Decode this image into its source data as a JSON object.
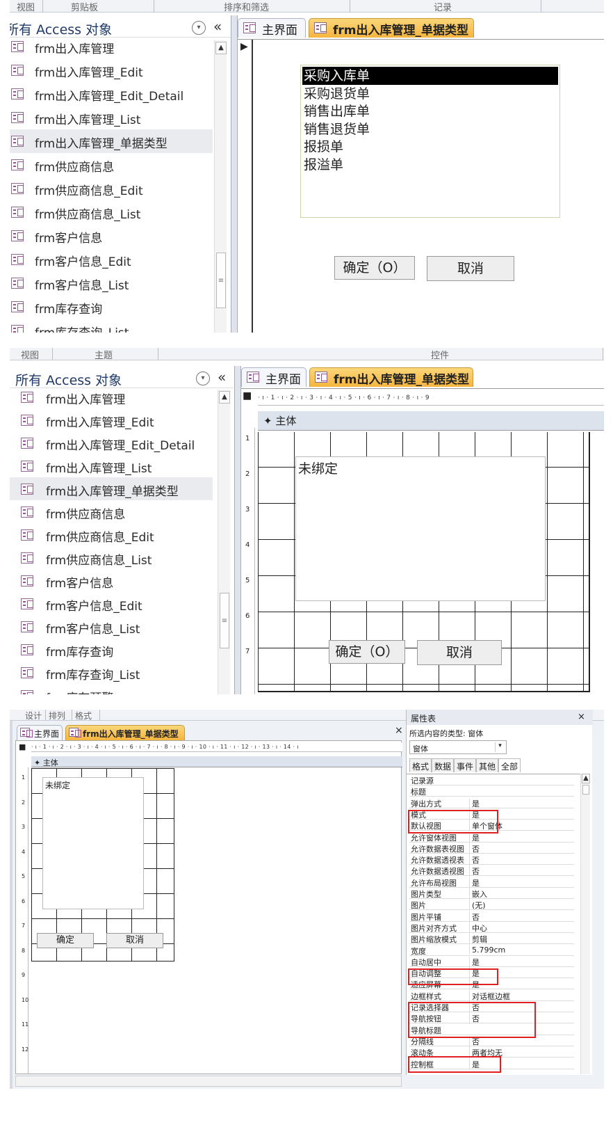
{
  "nav": {
    "title": "所有 Access 对象",
    "dropdown_glyph": "▾",
    "collapse_glyph": "«",
    "scroll_up": "▲",
    "thumb_grip": "≡",
    "items": [
      "frm出入库管理",
      "frm出入库管理_Edit",
      "frm出入库管理_Edit_Detail",
      "frm出入库管理_List",
      "frm出入库管理_单据类型",
      "frm供应商信息",
      "frm供应商信息_Edit",
      "frm供应商信息_List",
      "frm客户信息",
      "frm客户信息_Edit",
      "frm客户信息_List",
      "frm库存查询",
      "frm库存查询_List",
      "frm库存预警"
    ]
  },
  "panel1": {
    "top_segments": [
      "视图",
      "剪贴板",
      "排序和筛选",
      "记录"
    ],
    "record_marker": "▶",
    "listbox_items": [
      "采购入库单",
      "采购退货单",
      "销售出库单",
      "销售退货单",
      "报损单",
      "报溢单"
    ],
    "ok_button": "确定（O）",
    "cancel_button": "取消"
  },
  "tabs": {
    "home": "主界面",
    "form": "frm出入库管理_单据类型"
  },
  "panel2": {
    "top_segments": [
      "视图",
      "主题",
      "控件"
    ],
    "ruler_corner": "■",
    "ruler_text": "· ı · 1 · ı · 2 · ı · 3 · ı · 4 · ı · 5 · ı · 6 · ı · 7 · ı · 8 · ı · 9",
    "vruler_numbers": [
      "1",
      "2",
      "3",
      "4",
      "5",
      "6",
      "7"
    ],
    "section_glyph": "✦",
    "section_label": "主体",
    "unbound_label": "未绑定",
    "ok_button": "确定（O）",
    "cancel_button": "取消"
  },
  "panel3": {
    "top_segments": [
      "设计",
      "排列",
      "格式"
    ],
    "close_glyph": "×",
    "ruler_text": "· ı · 1 · ı · 2 · ı · 3 · ı · 4 · ı · 5 · ı · 6 · ı · 7 · ı · 8 · ı · 9 · ı · 10 · ı · 11 · ı · 12 · ı · 13 · ı · 14 · ı",
    "vruler_numbers": [
      "1",
      "2",
      "3",
      "4",
      "5",
      "6",
      "7",
      "8",
      "9",
      "10",
      "11",
      "12"
    ],
    "unbound_label": "未绑定",
    "ok_button": "确定",
    "cancel_button": "取消",
    "property_sheet": {
      "title": "属性表",
      "selection_type": "所选内容的类型: 窗体",
      "object_combo": "窗体",
      "tabs": [
        "格式",
        "数据",
        "事件",
        "其他",
        "全部"
      ],
      "rows": [
        {
          "name": "记录源",
          "value": ""
        },
        {
          "name": "标题",
          "value": ""
        },
        {
          "name": "弹出方式",
          "value": "是"
        },
        {
          "name": "模式",
          "value": "是"
        },
        {
          "name": "默认视图",
          "value": "单个窗体"
        },
        {
          "name": "允许窗体视图",
          "value": "是"
        },
        {
          "name": "允许数据表视图",
          "value": "否"
        },
        {
          "name": "允许数据透视表",
          "value": "否"
        },
        {
          "name": "允许数据透视图",
          "value": "否"
        },
        {
          "name": "允许布局视图",
          "value": "是"
        },
        {
          "name": "图片类型",
          "value": "嵌入"
        },
        {
          "name": "图片",
          "value": "(无)"
        },
        {
          "name": "图片平铺",
          "value": "否"
        },
        {
          "name": "图片对齐方式",
          "value": "中心"
        },
        {
          "name": "图片缩放模式",
          "value": "剪辑"
        },
        {
          "name": "宽度",
          "value": "5.799cm"
        },
        {
          "name": "自动居中",
          "value": "是"
        },
        {
          "name": "自动调整",
          "value": "是"
        },
        {
          "name": "适应屏幕",
          "value": "是"
        },
        {
          "name": "边框样式",
          "value": "对话框边框"
        },
        {
          "name": "记录选择器",
          "value": "否"
        },
        {
          "name": "导航按钮",
          "value": "否"
        },
        {
          "name": "导航标题",
          "value": ""
        },
        {
          "name": "分隔线",
          "value": "否"
        },
        {
          "name": "滚动条",
          "value": "两者均无"
        },
        {
          "name": "控制框",
          "value": "是"
        }
      ]
    }
  },
  "colors": {
    "highlight_box": "#e02020",
    "active_tab": "#f5b53e",
    "nav_title": "#1f3a68"
  }
}
